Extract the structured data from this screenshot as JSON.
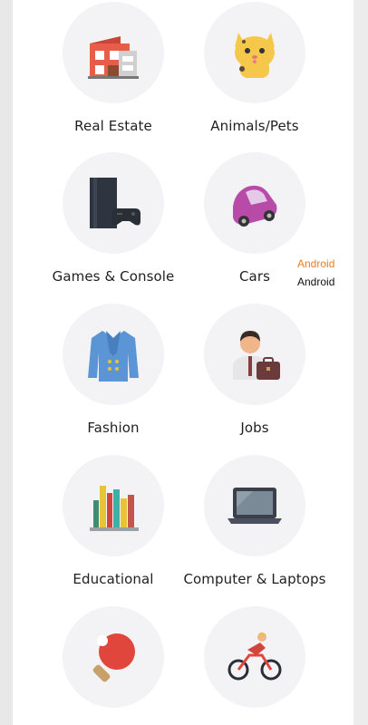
{
  "categories": [
    {
      "label": "Real Estate",
      "icon": "house-icon"
    },
    {
      "label": "Animals/Pets",
      "icon": "cat-icon"
    },
    {
      "label": "Games & Console",
      "icon": "console-icon"
    },
    {
      "label": "Cars",
      "icon": "car-icon"
    },
    {
      "label": "Fashion",
      "icon": "jacket-icon"
    },
    {
      "label": "Jobs",
      "icon": "businessman-icon"
    },
    {
      "label": "Educational",
      "icon": "books-icon"
    },
    {
      "label": "Computer & Laptops",
      "icon": "laptop-icon"
    },
    {
      "label": "",
      "icon": "ping-pong-icon"
    },
    {
      "label": "",
      "icon": "cyclist-icon"
    }
  ],
  "side_badge": {
    "image_alt": "Android",
    "caption": "Android"
  }
}
